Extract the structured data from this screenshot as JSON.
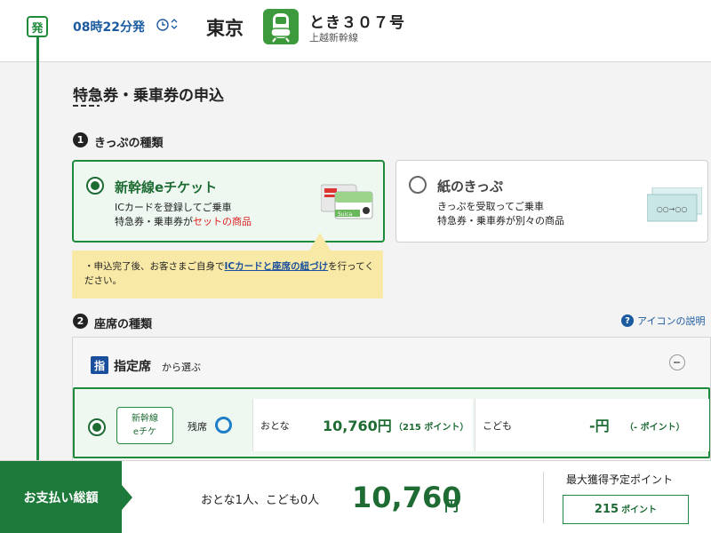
{
  "header": {
    "departure_badge": "発",
    "departure_time": "08時22分発",
    "station": "東京",
    "train_name": "とき３０７号",
    "train_line": "上越新幹線"
  },
  "page_title": "特急券・乗車券の申込",
  "ticket_type": {
    "step": "1",
    "label": "きっぷの種類",
    "options": [
      {
        "title": "新幹線eチケット",
        "desc_line1": "ICカードを登録してご乗車",
        "desc_line2_prefix": "特急券・乗車券が",
        "desc_line2_highlight": "セットの商品",
        "selected": true,
        "card_logo": "Suica"
      },
      {
        "title": "紙のきっぷ",
        "desc_line1": "きっぷを受取ってご乗車",
        "desc_line2": "特急券・乗車券が別々の商品",
        "selected": false,
        "ticket_text": "○○→○○"
      }
    ],
    "note_prefix": "・申込完了後、お客さまご自身で",
    "note_link": "ICカードと座席の紐づけ",
    "note_suffix": "を行ってください。"
  },
  "seat_type": {
    "step": "2",
    "label": "座席の種類",
    "help_link": "アイコンの説明",
    "section_icon": "指",
    "section_title": "指定席",
    "section_sub": "から選ぶ",
    "row": {
      "type_line1": "新幹線",
      "type_line2": "eチケ",
      "vacancy_label": "残席",
      "adult_label": "おとな",
      "adult_price": "10,760円",
      "adult_points": "（215 ポイント）",
      "child_label": "こども",
      "child_price": "-円",
      "child_points": "（- ポイント）"
    }
  },
  "footer": {
    "total_label": "お支払い総額",
    "passengers": "おとな1人、こども0人",
    "total_amount": "10,760",
    "total_unit": "円",
    "points_title": "最大獲得予定ポイント",
    "points_value": "215",
    "points_unit": "ポイント"
  },
  "colors": {
    "accent_green": "#1e8a3c",
    "dark_green": "#1e6b34",
    "link_blue": "#1a5a9e",
    "note_yellow": "#f9e9a6",
    "highlight_red": "#dd2222"
  },
  "icons": [
    "clock-icon",
    "sort-icon",
    "train-icon",
    "help-icon",
    "collapse-icon",
    "vacancy-icon"
  ]
}
